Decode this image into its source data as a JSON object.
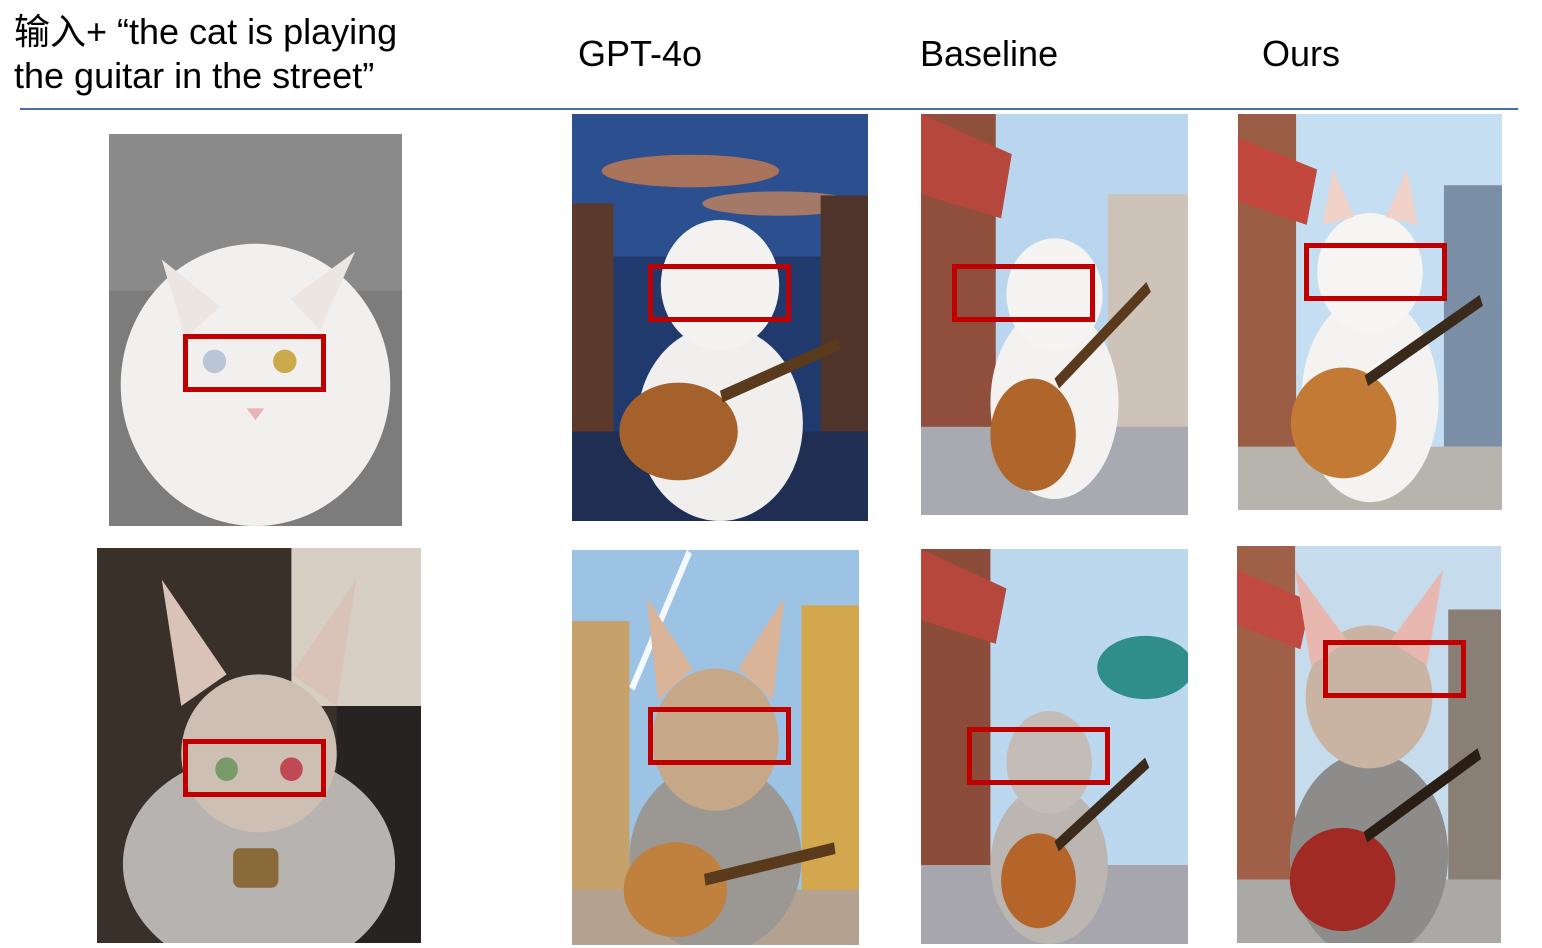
{
  "header": {
    "caption_line1": "输入+ “the cat is playing",
    "caption_line2": "the guitar in the street”",
    "columns": [
      "GPT-4o",
      "Baseline",
      "Ours"
    ]
  },
  "colors": {
    "highlight": "#c00000",
    "divider": "#4a6ea9"
  },
  "rows": [
    {
      "input": "white cat photo, heterochromatic eyes (blue and amber)",
      "gpt4o": "white cat with guitar under sunset sky",
      "baseline": "white cat with guitar on anime street",
      "ours": "white cat with guitar on anime street"
    },
    {
      "input": "fluffy calico kitten photo with padlock collar",
      "gpt4o": "calico kitten with guitar, comet sky",
      "baseline": "grey kitten with electric guitar on street",
      "ours": "fluffy kitten with red electric guitar on street"
    }
  ]
}
